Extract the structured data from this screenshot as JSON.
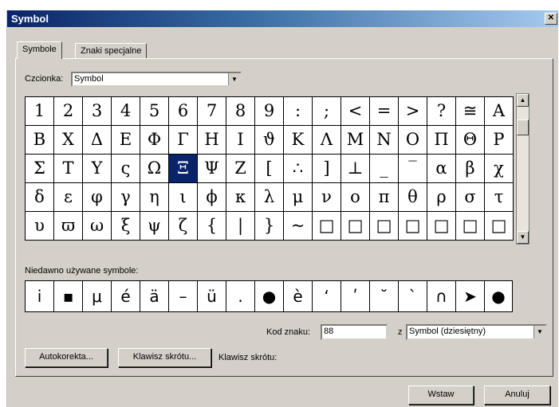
{
  "window": {
    "title": "Symbol",
    "close_glyph": "✕"
  },
  "tabs": [
    {
      "label": "Symbole",
      "active": true
    },
    {
      "label": "Znaki specjalne",
      "active": false
    }
  ],
  "font": {
    "label": "Czcionka:",
    "value": "Symbol"
  },
  "symbol_grid": {
    "rows": [
      [
        "1",
        "2",
        "3",
        "4",
        "5",
        "6",
        "7",
        "8",
        "9",
        ":",
        ";",
        "<",
        "=",
        ">",
        "?",
        "≅",
        "Α"
      ],
      [
        "Β",
        "Χ",
        "Δ",
        "Ε",
        "Φ",
        "Γ",
        "Η",
        "Ι",
        "ϑ",
        "Κ",
        "Λ",
        "Μ",
        "Ν",
        "Ο",
        "Π",
        "Θ",
        "Ρ"
      ],
      [
        "Σ",
        "Τ",
        "Υ",
        "ς",
        "Ω",
        "Ξ",
        "Ψ",
        "Ζ",
        "[",
        "∴",
        "]",
        "⊥",
        "_",
        "‾",
        "α",
        "β",
        "χ"
      ],
      [
        "δ",
        "ε",
        "φ",
        "γ",
        "η",
        "ι",
        "ϕ",
        "κ",
        "λ",
        "μ",
        "ν",
        "ο",
        "π",
        "θ",
        "ρ",
        "σ",
        "τ"
      ],
      [
        "υ",
        "ϖ",
        "ω",
        "ξ",
        "ψ",
        "ζ",
        "{",
        "|",
        "}",
        "~",
        "□",
        "□",
        "□",
        "□",
        "□",
        "□",
        "□"
      ]
    ],
    "selected": {
      "row": 2,
      "col": 5
    }
  },
  "scrollbar": {
    "up": "▲",
    "down": "▼"
  },
  "recent": {
    "label": "Niedawno używane symbole:",
    "symbols": [
      "i",
      "▪",
      "μ",
      "é",
      "ä",
      "–",
      "ü",
      ".",
      "●",
      "è",
      "‘",
      "ʹ",
      "˘",
      "`",
      "∩",
      "➤",
      "●"
    ]
  },
  "char_code": {
    "label": "Kod znaku:",
    "value": "88",
    "from_label": "z",
    "from_value": "Symbol (dziesiętny)"
  },
  "buttons": {
    "autocorrect": "Autokorekta...",
    "shortcut_key": "Klawisz skrótu...",
    "shortcut_label": "Klawisz skrótu:",
    "insert": "Wstaw",
    "cancel": "Anuluj"
  },
  "colors": {
    "selection": "#0a246a",
    "dialog_bg": "#d4d0c8"
  }
}
